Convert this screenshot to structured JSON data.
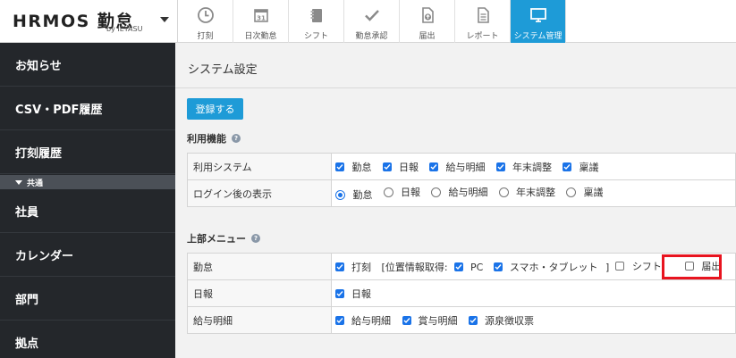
{
  "app": {
    "logo_text": "HRMOS 勤怠",
    "logo_sub": "by IEYASU"
  },
  "topnav": [
    {
      "label": "打刻",
      "icon": "clock-icon"
    },
    {
      "label": "日次勤怠",
      "icon": "calendar-icon"
    },
    {
      "label": "シフト",
      "icon": "notebook-icon"
    },
    {
      "label": "勤怠承認",
      "icon": "checkmark-icon"
    },
    {
      "label": "届出",
      "icon": "file-upload-icon"
    },
    {
      "label": "レポート",
      "icon": "document-icon"
    },
    {
      "label": "システム管理",
      "icon": "monitor-icon"
    }
  ],
  "sidebar": {
    "items": [
      {
        "label": "お知らせ"
      },
      {
        "label": "CSV・PDF履歴"
      },
      {
        "label": "打刻履歴"
      },
      {
        "label": "社員"
      },
      {
        "label": "カレンダー"
      },
      {
        "label": "部門"
      },
      {
        "label": "拠点"
      }
    ],
    "section_label": "共通"
  },
  "main": {
    "title": "システム設定",
    "register_label": "登録する",
    "section1": {
      "title": "利用機能",
      "help": "?",
      "rows": [
        {
          "label": "利用システム",
          "options": [
            "勤怠",
            "日報",
            "給与明細",
            "年末調整",
            "稟議"
          ]
        },
        {
          "label": "ログイン後の表示",
          "options": [
            "勤怠",
            "日報",
            "給与明細",
            "年末調整",
            "稟議"
          ]
        }
      ]
    },
    "section2": {
      "title": "上部メニュー",
      "help": "?",
      "rows": [
        {
          "label": "勤怠",
          "dakoku": "打刻",
          "location_prefix": "[位置情報取得:",
          "pc": "PC",
          "smartphone": "スマホ・タブレット",
          "bracket_close": "]",
          "shift": "シフト",
          "todokede": "届出"
        },
        {
          "label": "日報",
          "options": [
            "日報"
          ]
        },
        {
          "label": "給与明細",
          "options": [
            "給与明細",
            "賞与明細",
            "源泉徴収票"
          ]
        }
      ]
    }
  },
  "colors": {
    "accent": "#1e9bd7",
    "sidebar_bg": "#24272b",
    "checkbox": "#1a73e8",
    "highlight": "#e8141f"
  }
}
